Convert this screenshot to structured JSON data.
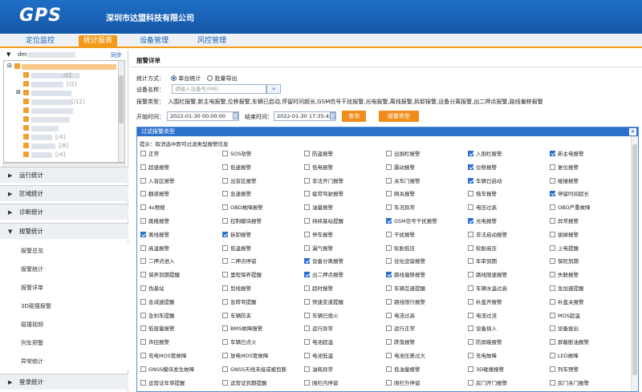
{
  "header": {
    "logo": "GPS",
    "company": "深圳市达盟科技有限公司"
  },
  "nav": [
    {
      "label": "定位监控",
      "active": false
    },
    {
      "label": "统计报表",
      "active": true
    },
    {
      "label": "设备管理",
      "active": false
    },
    {
      "label": "风控管理",
      "active": false
    }
  ],
  "tree": {
    "root": "dm",
    "sync": "同步",
    "counts": [
      "/2]",
      "[/2]",
      "[/12]",
      "[/4]",
      "[/6]",
      "[/4]",
      "/4]"
    ]
  },
  "menus": {
    "run": "运行统计",
    "area": "区域统计",
    "diag": "诊断统计",
    "alarm": "报警统计",
    "login": "登录统计"
  },
  "alarm_sub": [
    "报警总览",
    "报警统计",
    "报警详单",
    "3D碰撞报警",
    "碰撞视频",
    "列车预警",
    "异常统计"
  ],
  "main": {
    "title": "报警详单",
    "mode_label": "统计方式：",
    "mode_single": "单台统计",
    "mode_batch": "批量导出",
    "device_label": "设备名称：",
    "device_placeholder": "请输入设备号/IMEI",
    "alarm_type_label": "报警类型：",
    "alarm_type_value": "入围栏报警,新主电报警,位移报警,车辆已启动,停留时间超长,GSM信号干扰报警,光电报警,离线报警,拆卸报警,设备分离报警,出二押点报警,路线偏移报警",
    "start_label": "开始时间：",
    "start_value": "2022-01-30 00:00:00",
    "end_label": "结束时间：",
    "end_value": "2022-01-30 17:35:42",
    "query": "查询",
    "alarm_type_btn": "报警类型"
  },
  "dialog": {
    "title": "过滤报警类型",
    "tip": "提示：取消选中即可过滤类型报警信息",
    "rows": [
      [
        [
          "正常",
          false
        ],
        [
          "SOS劫警",
          false
        ],
        [
          "防盗报警",
          false
        ],
        [
          "出围栏报警",
          false
        ],
        [
          "入围栏报警",
          true
        ],
        [
          "新主电报警",
          true
        ]
      ],
      [
        [
          "超速报警",
          false
        ],
        [
          "低速报警",
          false
        ],
        [
          "低电报警",
          false
        ],
        [
          "震动报警",
          false
        ],
        [
          "位移报警",
          true
        ],
        [
          "复位报警",
          false
        ]
      ],
      [
        [
          "入盲区报警",
          false
        ],
        [
          "出盲区报警",
          false
        ],
        [
          "非法开门报警",
          false
        ],
        [
          "关车门报警",
          false
        ],
        [
          "车辆已启动",
          true
        ],
        [
          "碰撞报警",
          false
        ]
      ],
      [
        [
          "翻滚报警",
          false
        ],
        [
          "急速报警",
          false
        ],
        [
          "疲劳驾驶报警",
          false
        ],
        [
          "网关报警",
          false
        ],
        [
          "拖车报警",
          false
        ],
        [
          "停留时间超长",
          true
        ]
      ],
      [
        [
          "4s预搜",
          false
        ],
        [
          "OBD故障报警",
          false
        ],
        [
          "油量报警",
          false
        ],
        [
          "车况异常",
          false
        ],
        [
          "电压过高",
          false
        ],
        [
          "OBD严重故障",
          false
        ]
      ],
      [
        [
          "跳楼报警",
          false
        ],
        [
          "控制模块报警",
          false
        ],
        [
          "持续基站提醒",
          false
        ],
        [
          "GSM信号干扰报警",
          true
        ],
        [
          "光电报警",
          true
        ],
        [
          "异常报警",
          false
        ]
      ],
      [
        [
          "离线报警",
          true
        ],
        [
          "拆卸报警",
          true
        ],
        [
          "停车报警",
          false
        ],
        [
          "干扰报警",
          false
        ],
        [
          "非法启动报警",
          false
        ],
        [
          "拔掉报警",
          false
        ]
      ],
      [
        [
          "高温报警",
          false
        ],
        [
          "低温报警",
          false
        ],
        [
          "漏气报警",
          false
        ],
        [
          "轮胎低压",
          false
        ],
        [
          "轮胎高压",
          false
        ],
        [
          "上电提醒",
          false
        ]
      ],
      [
        [
          "二押点进入",
          false
        ],
        [
          "二押点停留",
          false
        ],
        [
          "设备分离报警",
          true
        ],
        [
          "住址逗留报警",
          false
        ],
        [
          "年审到期",
          false
        ],
        [
          "保险到期",
          false
        ]
      ],
      [
        [
          "保养到期提醒",
          false
        ],
        [
          "里程保养提醒",
          false
        ],
        [
          "出二押点报警",
          true
        ],
        [
          "路线偏移报警",
          true
        ],
        [
          "路线限速报警",
          false
        ],
        [
          "失联报警",
          false
        ]
      ],
      [
        [
          "伪基站",
          false
        ],
        [
          "剪线报警",
          false
        ],
        [
          "超时报警",
          false
        ],
        [
          "车辆怠速提醒",
          false
        ],
        [
          "车辆水温过高",
          false
        ],
        [
          "急加速提醒",
          false
        ]
      ],
      [
        [
          "急减速提醒",
          false
        ],
        [
          "急转弯提醒",
          false
        ],
        [
          "快速变道提醒",
          false
        ],
        [
          "路线限行报警",
          false
        ],
        [
          "补盖开报警",
          false
        ],
        [
          "补盖关报警",
          false
        ]
      ],
      [
        [
          "急刹车提醒",
          false
        ],
        [
          "车辆防夹",
          false
        ],
        [
          "车辆已熄火",
          false
        ],
        [
          "电流过高",
          false
        ],
        [
          "电流过流",
          false
        ],
        [
          "MOS超温",
          false
        ]
      ],
      [
        [
          "低容量报警",
          false
        ],
        [
          "BMS故障报警",
          false
        ],
        [
          "运行异常",
          false
        ],
        [
          "运行正常",
          false
        ],
        [
          "设备插入",
          false
        ],
        [
          "设备拔出",
          false
        ]
      ],
      [
        [
          "声控报警",
          false
        ],
        [
          "车辆已点火",
          false
        ],
        [
          "电池超温",
          false
        ],
        [
          "跌落报警",
          false
        ],
        [
          "防屏蔽报警",
          false
        ],
        [
          "屏蔽断油报警",
          false
        ]
      ],
      [
        [
          "充电MOS管故障",
          false
        ],
        [
          "放电MOS管故障",
          false
        ],
        [
          "电池低温",
          false
        ],
        [
          "电池压差过大",
          false
        ],
        [
          "充电故障",
          false
        ],
        [
          "LED故障",
          false
        ]
      ],
      [
        [
          "GNSS模块发生故障",
          false
        ],
        [
          "GNSS天线未接或被剪断",
          false
        ],
        [
          "油耗异常",
          false
        ],
        [
          "低油量报警",
          false
        ],
        [
          "3D碰撞报警",
          false
        ],
        [
          "列车预警",
          false
        ]
      ],
      [
        [
          "运营证年审提醒",
          false
        ],
        [
          "运营证到期提醒",
          false
        ],
        [
          "围栏内停留",
          false
        ],
        [
          "围栏外停留",
          false
        ],
        [
          "房门开门报警",
          false
        ],
        [
          "房门关门报警",
          false
        ]
      ]
    ]
  },
  "colors": {
    "brand": "#1a62bd",
    "accent": "#f39a1a",
    "check": "#2f6fd0"
  }
}
